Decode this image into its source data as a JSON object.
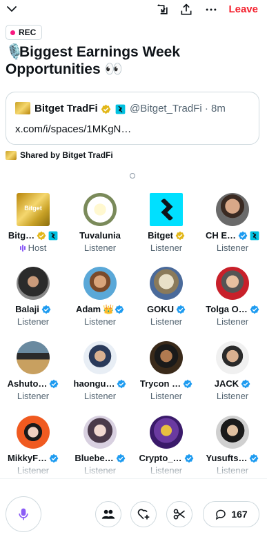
{
  "header": {
    "leave_label": "Leave",
    "rec_label": "REC",
    "title": "Biggest Earnings Week Opportunities",
    "title_lead_emoji": "🎙️",
    "title_trail_emoji": "👀"
  },
  "tweet": {
    "name": "Bitget TradFi",
    "handle": "@Bitget_TradFi · 8m",
    "link": "x.com/i/spaces/1MKgN…"
  },
  "shared_by": "Shared by Bitget TradFi",
  "participants": [
    {
      "name": "Bitg…",
      "role": "Host",
      "avatar": "bitget-tradfi-logo",
      "badges": [
        "gold-check",
        "s-badge"
      ]
    },
    {
      "name": "Tuvalunia",
      "role": "Listener",
      "avatar": "frangipani-flower",
      "badges": []
    },
    {
      "name": "Bitget",
      "role": "Listener",
      "avatar": "bitget-logo",
      "badges": [
        "gold-check"
      ]
    },
    {
      "name": "CH E…",
      "role": "Listener",
      "avatar": "man-portrait",
      "badges": [
        "blue-check",
        "s-badge"
      ]
    },
    {
      "name": "Balaji",
      "role": "Listener",
      "avatar": "hooded-man",
      "badges": [
        "blue-check"
      ]
    },
    {
      "name": "Adam",
      "role": "Listener",
      "avatar": "bearded-man",
      "badges": [
        "crown",
        "blue-check"
      ]
    },
    {
      "name": "GOKU",
      "role": "Listener",
      "avatar": "anime-character",
      "badges": [
        "blue-check"
      ]
    },
    {
      "name": "Tolga O…",
      "role": "Listener",
      "avatar": "man-red-background",
      "badges": [
        "blue-check"
      ]
    },
    {
      "name": "Ashuto…",
      "role": "Listener",
      "avatar": "pixel-punk",
      "badges": [
        "blue-check"
      ]
    },
    {
      "name": "haongu…",
      "role": "Listener",
      "avatar": "man-suit-blue",
      "badges": [
        "blue-check"
      ]
    },
    {
      "name": "Trycon …",
      "role": "Listener",
      "avatar": "man-dark-portrait",
      "badges": [
        "blue-check"
      ]
    },
    {
      "name": "JACK",
      "role": "Listener",
      "avatar": "smiling-man",
      "badges": [
        "blue-check"
      ]
    },
    {
      "name": "MikkyF…",
      "role": "Listener",
      "avatar": "anime-red-hair",
      "badges": [
        "blue-check"
      ]
    },
    {
      "name": "Bluebe…",
      "role": "Listener",
      "avatar": "anime-girl",
      "badges": [
        "blue-check"
      ]
    },
    {
      "name": "Crypto_…",
      "role": "Listener",
      "avatar": "crypto-glasses",
      "badges": [
        "blue-check"
      ]
    },
    {
      "name": "Yusufts…",
      "role": "Listener",
      "avatar": "man-cap-glasses",
      "badges": [
        "blue-check"
      ]
    }
  ],
  "comments_count": "167",
  "colors": {
    "accent": "#1d9bf0",
    "leave": "#f4212e",
    "rec_dot": "#f91880",
    "mic": "#8b5cf6",
    "gold": "#d4a017"
  }
}
